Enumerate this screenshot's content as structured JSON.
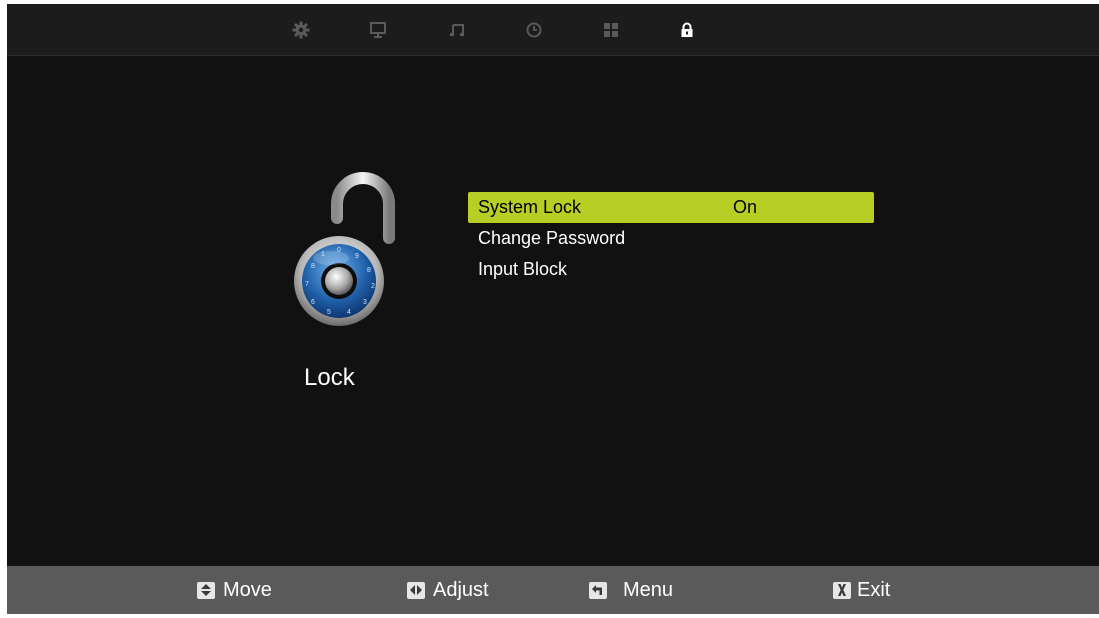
{
  "topbar": {
    "tabs": [
      {
        "icon": "gear-icon",
        "active": false
      },
      {
        "icon": "monitor-icon",
        "active": false
      },
      {
        "icon": "music-note-icon",
        "active": false
      },
      {
        "icon": "clock-icon",
        "active": false
      },
      {
        "icon": "grid-icon",
        "active": false
      },
      {
        "icon": "lock-icon",
        "active": true
      }
    ]
  },
  "section": {
    "title": "Lock",
    "icon": "padlock-illustration"
  },
  "menu": {
    "items": [
      {
        "label": "System Lock",
        "value": "On",
        "selected": true
      },
      {
        "label": "Change Password",
        "value": "",
        "selected": false
      },
      {
        "label": "Input Block",
        "value": "",
        "selected": false
      }
    ]
  },
  "hints": [
    {
      "icon": "up-down-key-icon",
      "label": "Move"
    },
    {
      "icon": "left-right-key-icon",
      "label": "Adjust"
    },
    {
      "icon": "return-key-icon",
      "label": "Menu"
    },
    {
      "icon": "exit-key-icon",
      "label": "Exit"
    }
  ],
  "colors": {
    "highlight": "#b7cf25",
    "background": "#111111",
    "bottombar": "#5a5a5a",
    "inactive_icon": "#5a5a5a",
    "active_icon": "#ffffff"
  }
}
